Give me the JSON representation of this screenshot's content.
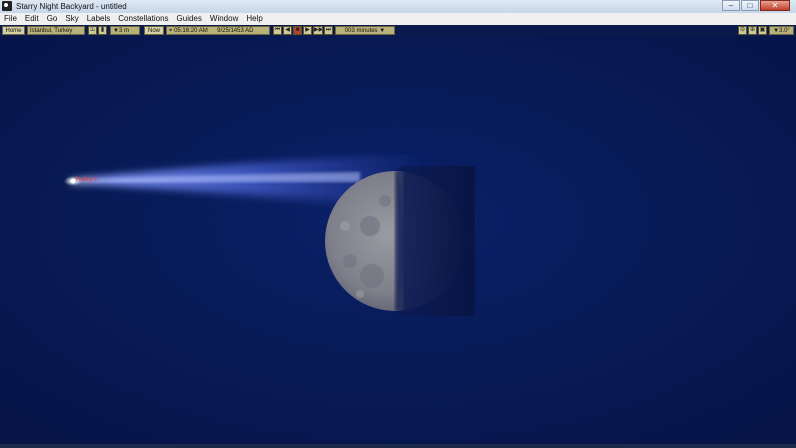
{
  "window": {
    "title": "Starry Night Backyard - untitled"
  },
  "menu": [
    "File",
    "Edit",
    "Go",
    "Sky",
    "Labels",
    "Constellations",
    "Guides",
    "Window",
    "Help"
  ],
  "toolbar": {
    "home_label": "Home",
    "location": "Istanbul, Turkey",
    "altitude": "▼3 m",
    "now_label": "Now",
    "time": "05:16:20 AM",
    "date": "9/25/1453 AD",
    "time_step": "003 minutes ▼",
    "field_of_view": "▼3.0°"
  },
  "sky": {
    "comet_label": "Halley's",
    "colors": {
      "background": "#061649",
      "comet_tail": "#4f6ae0",
      "moon": "#8a8a94"
    }
  },
  "icons": {
    "window_buttons": [
      "minimize-icon",
      "maximize-icon",
      "close-icon"
    ],
    "playback": [
      "skip-back-icon",
      "step-back-icon",
      "stop-icon",
      "step-forward-icon",
      "play-icon",
      "skip-forward-icon"
    ],
    "zoom": [
      "zoom-out-icon",
      "zoom-in-icon",
      "zoom-box-icon"
    ]
  }
}
